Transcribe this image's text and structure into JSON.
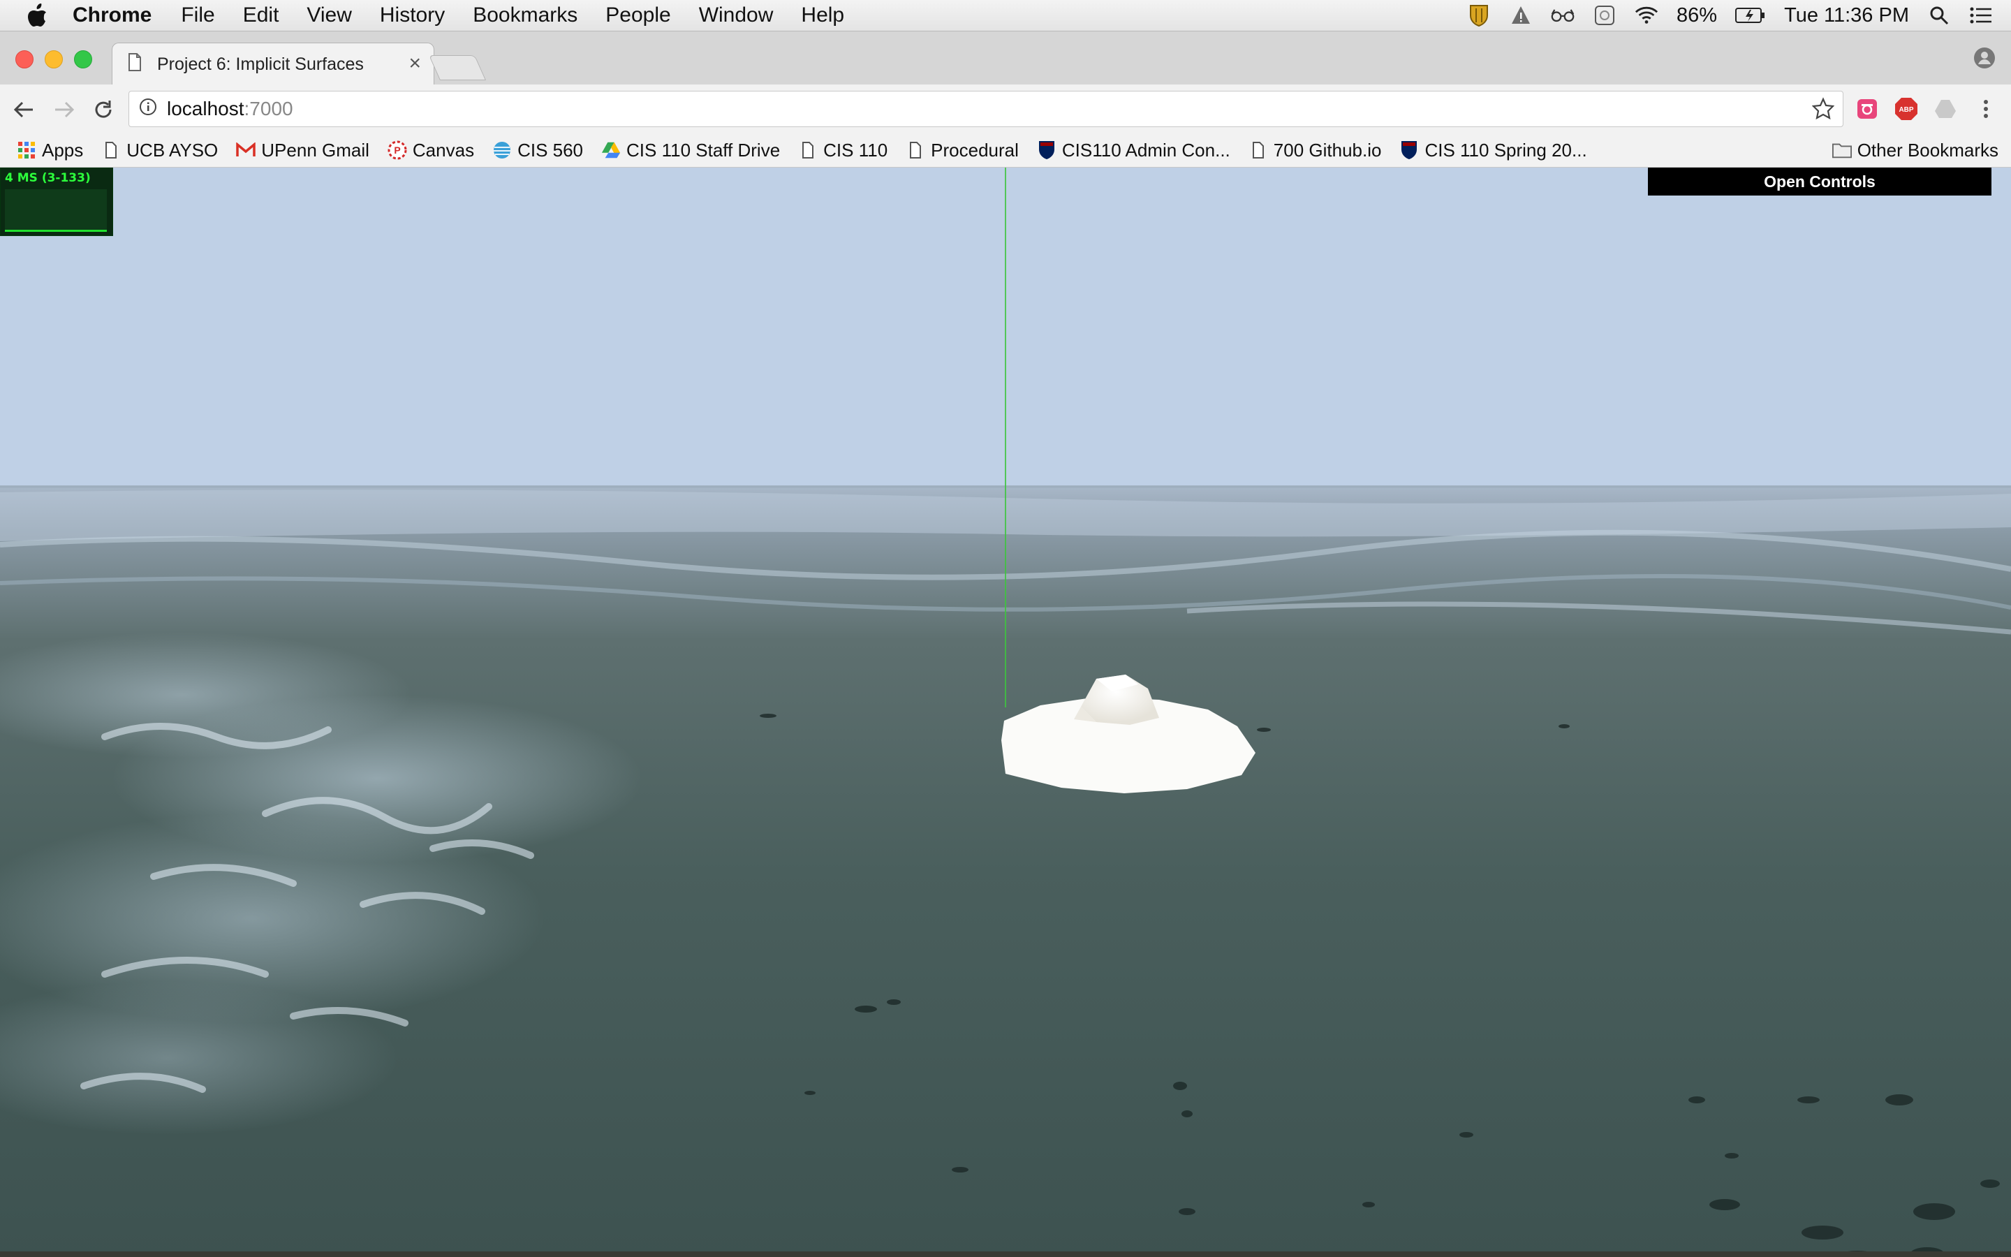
{
  "menubar": {
    "app": "Chrome",
    "items": [
      "File",
      "Edit",
      "View",
      "History",
      "Bookmarks",
      "People",
      "Window",
      "Help"
    ],
    "battery": "86%",
    "clock": "Tue 11:36 PM"
  },
  "tab": {
    "title": "Project 6: Implicit Surfaces"
  },
  "omnibox": {
    "host": "localhost",
    "port": ":7000"
  },
  "bookmarks": {
    "items": [
      "Apps",
      "UCB AYSO",
      "UPenn Gmail",
      "Canvas",
      "CIS 560",
      "CIS 110 Staff Drive",
      "CIS 110",
      "Procedural",
      "CIS110 Admin Con...",
      "700 Github.io",
      "CIS 110 Spring 20..."
    ],
    "other": "Other Bookmarks"
  },
  "viewport": {
    "stats": "4 MS (3-133)",
    "controls_button": "Open Controls"
  },
  "colors": {
    "sky": "#bfd0e6",
    "ocean_far": "#7b8b98",
    "ocean_near": "#3f5654",
    "iceberg": "#f7f7f3",
    "stats_green": "#2cff3c"
  }
}
